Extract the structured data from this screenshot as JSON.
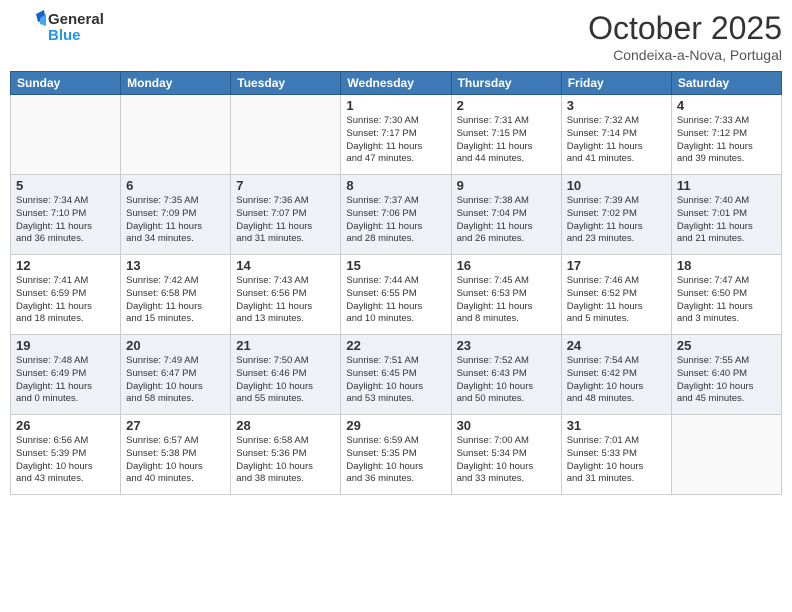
{
  "header": {
    "logo_line1": "General",
    "logo_line2": "Blue",
    "month_title": "October 2025",
    "location": "Condeixa-a-Nova, Portugal"
  },
  "days_of_week": [
    "Sunday",
    "Monday",
    "Tuesday",
    "Wednesday",
    "Thursday",
    "Friday",
    "Saturday"
  ],
  "weeks": [
    [
      {
        "day": "",
        "info": ""
      },
      {
        "day": "",
        "info": ""
      },
      {
        "day": "",
        "info": ""
      },
      {
        "day": "1",
        "info": "Sunrise: 7:30 AM\nSunset: 7:17 PM\nDaylight: 11 hours\nand 47 minutes."
      },
      {
        "day": "2",
        "info": "Sunrise: 7:31 AM\nSunset: 7:15 PM\nDaylight: 11 hours\nand 44 minutes."
      },
      {
        "day": "3",
        "info": "Sunrise: 7:32 AM\nSunset: 7:14 PM\nDaylight: 11 hours\nand 41 minutes."
      },
      {
        "day": "4",
        "info": "Sunrise: 7:33 AM\nSunset: 7:12 PM\nDaylight: 11 hours\nand 39 minutes."
      }
    ],
    [
      {
        "day": "5",
        "info": "Sunrise: 7:34 AM\nSunset: 7:10 PM\nDaylight: 11 hours\nand 36 minutes."
      },
      {
        "day": "6",
        "info": "Sunrise: 7:35 AM\nSunset: 7:09 PM\nDaylight: 11 hours\nand 34 minutes."
      },
      {
        "day": "7",
        "info": "Sunrise: 7:36 AM\nSunset: 7:07 PM\nDaylight: 11 hours\nand 31 minutes."
      },
      {
        "day": "8",
        "info": "Sunrise: 7:37 AM\nSunset: 7:06 PM\nDaylight: 11 hours\nand 28 minutes."
      },
      {
        "day": "9",
        "info": "Sunrise: 7:38 AM\nSunset: 7:04 PM\nDaylight: 11 hours\nand 26 minutes."
      },
      {
        "day": "10",
        "info": "Sunrise: 7:39 AM\nSunset: 7:02 PM\nDaylight: 11 hours\nand 23 minutes."
      },
      {
        "day": "11",
        "info": "Sunrise: 7:40 AM\nSunset: 7:01 PM\nDaylight: 11 hours\nand 21 minutes."
      }
    ],
    [
      {
        "day": "12",
        "info": "Sunrise: 7:41 AM\nSunset: 6:59 PM\nDaylight: 11 hours\nand 18 minutes."
      },
      {
        "day": "13",
        "info": "Sunrise: 7:42 AM\nSunset: 6:58 PM\nDaylight: 11 hours\nand 15 minutes."
      },
      {
        "day": "14",
        "info": "Sunrise: 7:43 AM\nSunset: 6:56 PM\nDaylight: 11 hours\nand 13 minutes."
      },
      {
        "day": "15",
        "info": "Sunrise: 7:44 AM\nSunset: 6:55 PM\nDaylight: 11 hours\nand 10 minutes."
      },
      {
        "day": "16",
        "info": "Sunrise: 7:45 AM\nSunset: 6:53 PM\nDaylight: 11 hours\nand 8 minutes."
      },
      {
        "day": "17",
        "info": "Sunrise: 7:46 AM\nSunset: 6:52 PM\nDaylight: 11 hours\nand 5 minutes."
      },
      {
        "day": "18",
        "info": "Sunrise: 7:47 AM\nSunset: 6:50 PM\nDaylight: 11 hours\nand 3 minutes."
      }
    ],
    [
      {
        "day": "19",
        "info": "Sunrise: 7:48 AM\nSunset: 6:49 PM\nDaylight: 11 hours\nand 0 minutes."
      },
      {
        "day": "20",
        "info": "Sunrise: 7:49 AM\nSunset: 6:47 PM\nDaylight: 10 hours\nand 58 minutes."
      },
      {
        "day": "21",
        "info": "Sunrise: 7:50 AM\nSunset: 6:46 PM\nDaylight: 10 hours\nand 55 minutes."
      },
      {
        "day": "22",
        "info": "Sunrise: 7:51 AM\nSunset: 6:45 PM\nDaylight: 10 hours\nand 53 minutes."
      },
      {
        "day": "23",
        "info": "Sunrise: 7:52 AM\nSunset: 6:43 PM\nDaylight: 10 hours\nand 50 minutes."
      },
      {
        "day": "24",
        "info": "Sunrise: 7:54 AM\nSunset: 6:42 PM\nDaylight: 10 hours\nand 48 minutes."
      },
      {
        "day": "25",
        "info": "Sunrise: 7:55 AM\nSunset: 6:40 PM\nDaylight: 10 hours\nand 45 minutes."
      }
    ],
    [
      {
        "day": "26",
        "info": "Sunrise: 6:56 AM\nSunset: 5:39 PM\nDaylight: 10 hours\nand 43 minutes."
      },
      {
        "day": "27",
        "info": "Sunrise: 6:57 AM\nSunset: 5:38 PM\nDaylight: 10 hours\nand 40 minutes."
      },
      {
        "day": "28",
        "info": "Sunrise: 6:58 AM\nSunset: 5:36 PM\nDaylight: 10 hours\nand 38 minutes."
      },
      {
        "day": "29",
        "info": "Sunrise: 6:59 AM\nSunset: 5:35 PM\nDaylight: 10 hours\nand 36 minutes."
      },
      {
        "day": "30",
        "info": "Sunrise: 7:00 AM\nSunset: 5:34 PM\nDaylight: 10 hours\nand 33 minutes."
      },
      {
        "day": "31",
        "info": "Sunrise: 7:01 AM\nSunset: 5:33 PM\nDaylight: 10 hours\nand 31 minutes."
      },
      {
        "day": "",
        "info": ""
      }
    ]
  ]
}
